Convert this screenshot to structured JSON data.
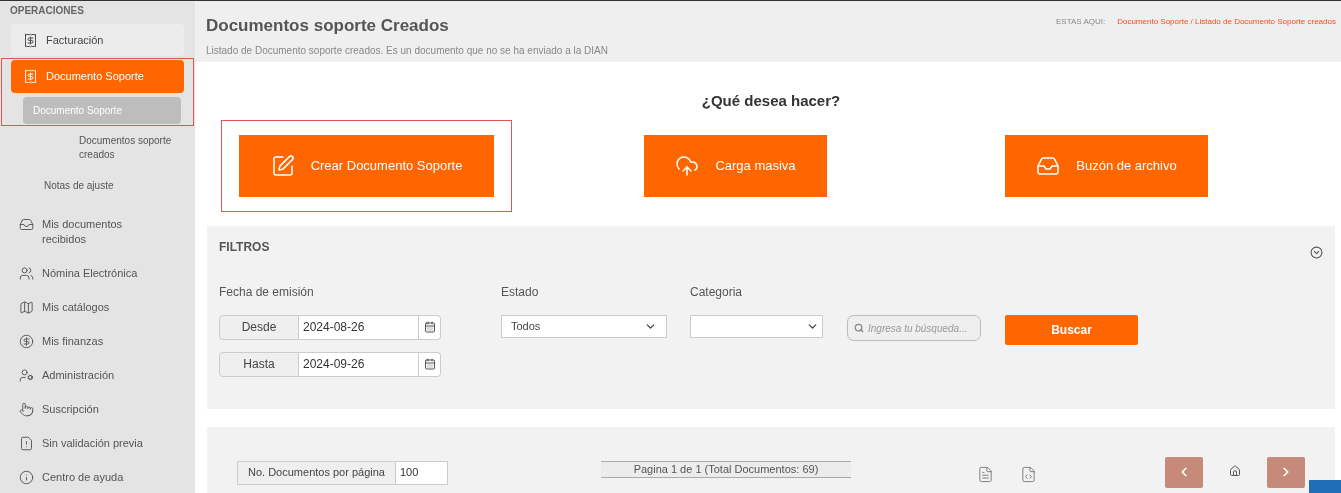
{
  "sidebar": {
    "section": "OPERACIONES",
    "items": [
      {
        "label": "Facturación",
        "selected": false,
        "highlighted": false
      },
      {
        "label": "Documento Soporte",
        "selected": true,
        "highlighted": true,
        "children": [
          {
            "label": "Documento Soporte",
            "selected": true,
            "children": [
              {
                "label": "Documentos soporte creados",
                "selected": false
              }
            ]
          },
          {
            "label": "Notas de ajuste",
            "selected": false
          }
        ]
      },
      {
        "label": "Mis documentos recibidos",
        "selected": false,
        "highlighted": false
      },
      {
        "label": "Nómina Electrónica",
        "selected": false,
        "highlighted": false
      },
      {
        "label": "Mis catálogos",
        "selected": false,
        "highlighted": false
      },
      {
        "label": "Mis finanzas",
        "selected": false,
        "highlighted": false
      },
      {
        "label": "Administración",
        "selected": false,
        "highlighted": false
      },
      {
        "label": "Suscripción",
        "selected": false,
        "highlighted": false
      },
      {
        "label": "Sin validación previa",
        "selected": false,
        "highlighted": false
      },
      {
        "label": "Centro de ayuda",
        "selected": false,
        "highlighted": false
      }
    ]
  },
  "header": {
    "title": "Documentos soporte Creados",
    "subtitle": "Listado de Documento soporte creados. Es un documento que no se ha enviado a la DIAN",
    "breadcrumb_label": "ESTAS AQUI:",
    "breadcrumb": "Documento Soporte / Listado de Documento Soporte creados"
  },
  "actions": {
    "title": "¿Qué desea hacer?",
    "buttons": [
      {
        "label": "Crear Documento Soporte",
        "highlighted": true
      },
      {
        "label": "Carga masiva",
        "highlighted": false
      },
      {
        "label": "Buzón de archivo",
        "highlighted": false
      }
    ]
  },
  "filters": {
    "title": "FILTROS",
    "expanded": true,
    "date_label": "Fecha de emisión",
    "from_label": "Desde",
    "from_value": "2024-08-26",
    "to_label": "Hasta",
    "to_value": "2024-09-26",
    "status_label": "Estado",
    "status_value": "Todos",
    "category_label": "Categoria",
    "search_placeholder": "Ingresa tu búsqueda...",
    "search_button": "Buscar"
  },
  "pagination": {
    "per_page_label": "No. Documentos por página",
    "per_page_value": "100",
    "page_info": "Pagina 1 de 1 (Total Documentos: 69)"
  }
}
